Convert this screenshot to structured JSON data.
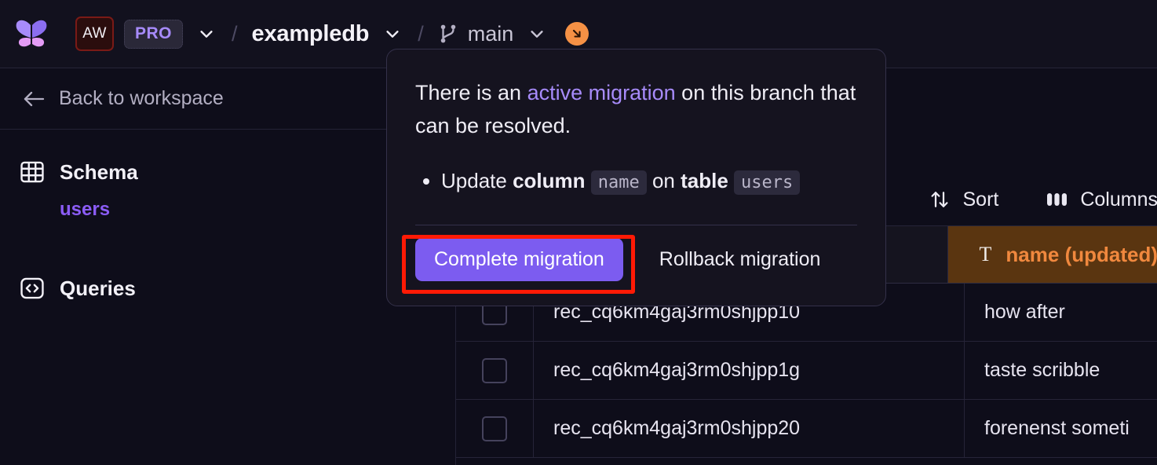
{
  "header": {
    "logo_icon": "butterfly-logo",
    "org_badge": "AW",
    "plan_badge": "PRO",
    "separator": "/",
    "database_name": "exampledb",
    "branch_icon": "git-branch-icon",
    "branch_name": "main",
    "migration_indicator_icon": "arrow-down-right-icon",
    "migration_indicator_color": "#f59145",
    "chevron_icon": "chevron-down-icon"
  },
  "sidebar": {
    "back_label": "Back to workspace",
    "back_icon": "arrow-left-icon",
    "sections": [
      {
        "label": "Schema",
        "icon": "table-grid-icon",
        "search_icon": "search-icon",
        "items": [
          {
            "label": "users",
            "active": true
          }
        ]
      },
      {
        "label": "Queries",
        "icon": "code-brackets-icon",
        "search_icon": "search-icon",
        "items": []
      }
    ],
    "active_color": "#8b5cf6"
  },
  "toolbar": {
    "sort_label": "Sort",
    "sort_icon": "sort-arrows-icon",
    "columns_label": "Columns",
    "columns_icon": "columns-icon"
  },
  "table": {
    "columns": [
      {
        "key": "check",
        "label": "",
        "icon": ""
      },
      {
        "key": "id",
        "label": "",
        "icon": ""
      },
      {
        "key": "name",
        "label": "name (updated)",
        "icon": "text-type-icon",
        "highlight": true,
        "bg": "#5a3510",
        "fg": "#f0883e"
      }
    ],
    "rows": [
      {
        "id": "rec_cq6km4gaj3rm0shjpp10",
        "name": "how after"
      },
      {
        "id": "rec_cq6km4gaj3rm0shjpp1g",
        "name": "taste scribble"
      },
      {
        "id": "rec_cq6km4gaj3rm0shjpp20",
        "name": "forenenst someti"
      }
    ]
  },
  "popover": {
    "line1_pre": "There is an ",
    "line1_link": "active migration",
    "line1_post": " on this branch that can be resolved.",
    "bullet": {
      "pre": "Update ",
      "bold1": "column",
      "code1": "name",
      "mid": " on ",
      "bold2": "table",
      "code2": "users"
    },
    "primary_button": "Complete migration",
    "secondary_button": "Rollback migration",
    "primary_color": "#7c5cf0",
    "link_color": "#a78bfa"
  },
  "annotation": {
    "highlight_color": "#ff1a05",
    "target": "complete-migration-button"
  }
}
